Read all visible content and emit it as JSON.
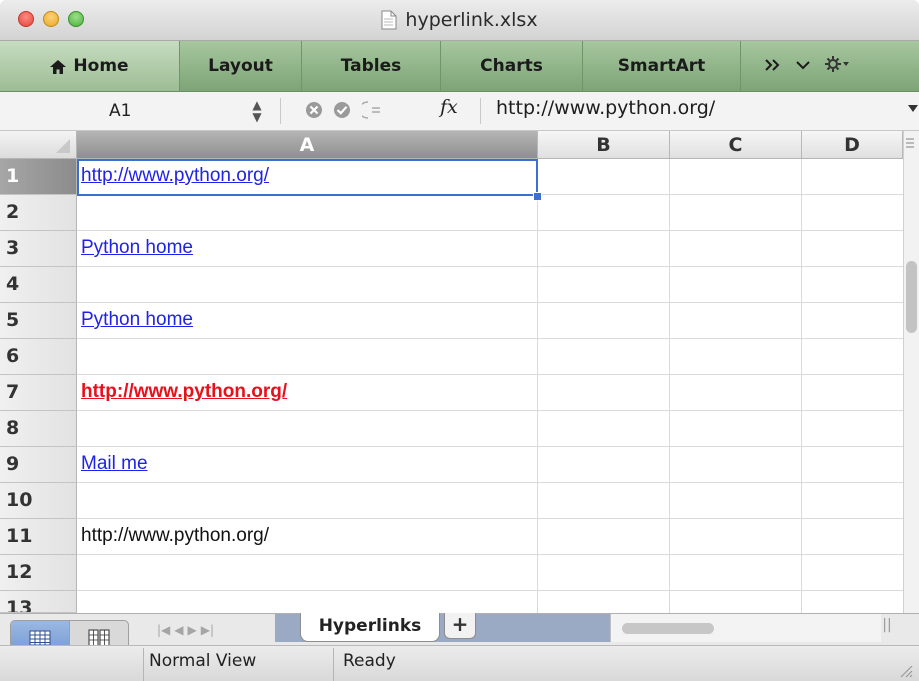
{
  "window": {
    "title": "hyperlink.xlsx"
  },
  "ribbon": {
    "tabs": [
      "Home",
      "Layout",
      "Tables",
      "Charts",
      "SmartArt"
    ]
  },
  "formula_bar": {
    "cell_ref": "A1",
    "fx_label": "fx",
    "value": "http://www.python.org/"
  },
  "columns": [
    "A",
    "B",
    "C",
    "D"
  ],
  "rows": [
    "1",
    "2",
    "3",
    "4",
    "5",
    "6",
    "7",
    "8",
    "9",
    "10",
    "11",
    "12",
    "13"
  ],
  "cells": {
    "a1": "http://www.python.org/",
    "a3": "Python home",
    "a5": "Python home",
    "a7": "http://www.python.org/",
    "a9": "Mail me",
    "a11": "http://www.python.org/"
  },
  "colors": {
    "link": "#1f22ea",
    "link_red": "#e8101c",
    "selection": "#3d6fd1",
    "ribbon": "#8fb487"
  },
  "sheets": {
    "active": "Hyperlinks",
    "add_label": "+"
  },
  "status": {
    "view": "Normal View",
    "state": "Ready"
  }
}
